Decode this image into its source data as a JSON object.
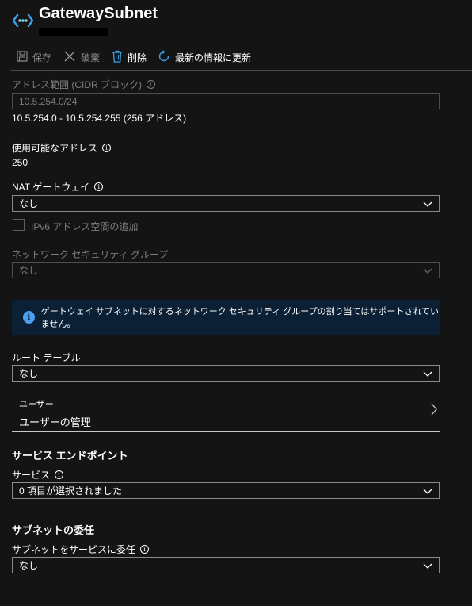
{
  "header": {
    "title": "GatewaySubnet",
    "icon": "subnet-icon"
  },
  "toolbar": {
    "save_label": "保存",
    "discard_label": "破棄",
    "delete_label": "削除",
    "refresh_label": "最新の情報に更新"
  },
  "address_range": {
    "label": "アドレス範囲 (CIDR ブロック)",
    "value": "10.5.254.0/24",
    "range_text": "10.5.254.0 - 10.5.254.255 (256 アドレス)"
  },
  "available": {
    "label": "使用可能なアドレス",
    "value": "250"
  },
  "nat_gateway": {
    "label": "NAT ゲートウェイ",
    "value": "なし"
  },
  "ipv6": {
    "label": "IPv6 アドレス空間の追加"
  },
  "nsg": {
    "label": "ネットワーク セキュリティ グループ",
    "value": "なし"
  },
  "banner": {
    "text": "ゲートウェイ サブネットに対するネットワーク セキュリティ グループの割り当てはサポートされていません。"
  },
  "route_table": {
    "label": "ルート テーブル",
    "value": "なし"
  },
  "users": {
    "label": "ユーザー",
    "link_text": "ユーザーの管理"
  },
  "service_endpoints": {
    "heading": "サービス エンドポイント",
    "label": "サービス",
    "value": "0 項目が選択されました"
  },
  "delegation": {
    "heading": "サブネットの委任",
    "label": "サブネットをサービスに委任",
    "value": "なし"
  },
  "colors": {
    "background": "#141414",
    "accent": "#4aa0ee",
    "banner_bg": "#0b1f35"
  }
}
